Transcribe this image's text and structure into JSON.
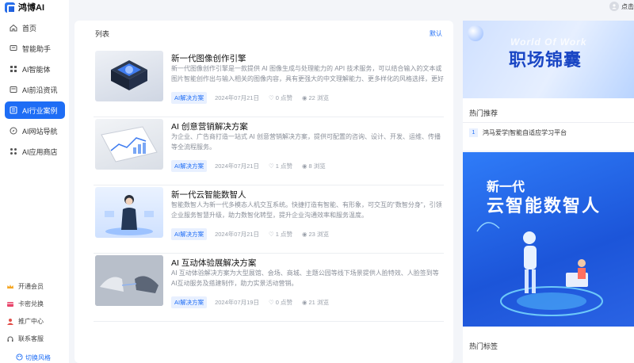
{
  "brand": {
    "name": "鸿博AI"
  },
  "nav": [
    {
      "label": "首页",
      "icon": "home-icon"
    },
    {
      "label": "智能助手",
      "icon": "chat-icon"
    },
    {
      "label": "AI智能体",
      "icon": "grid-icon"
    },
    {
      "label": "AI前沿资讯",
      "icon": "news-icon"
    },
    {
      "label": "AI行业案例",
      "icon": "case-icon",
      "active": true
    },
    {
      "label": "AI网站导航",
      "icon": "compass-icon"
    },
    {
      "label": "AI应用商店",
      "icon": "apps-icon"
    }
  ],
  "bottom_nav": [
    {
      "label": "开通会员",
      "icon": "crown-icon"
    },
    {
      "label": "卡密兑换",
      "icon": "card-icon"
    },
    {
      "label": "推广中心",
      "icon": "promo-icon"
    },
    {
      "label": "联系客服",
      "icon": "headset-icon"
    }
  ],
  "theme_toggle": "切换风格",
  "user": {
    "login_label": "点击"
  },
  "list": {
    "header": "列表",
    "sort_label": "默认",
    "articles": [
      {
        "title": "新一代图像创作引擎",
        "desc": "新一代图像创作引擎是一款提供 AI 图像生成与处理能力的 API 技术服务，可以结合输入的文本或图片智能创作出与输入相关的图像内容，具有更强大的中文理解能力、更多样化的风格选择，更好支持中...",
        "tag": "AI解决方案",
        "date": "2024年07月21日",
        "likes": "0 点赞",
        "views": "22 浏览"
      },
      {
        "title": "AI 创意营销解决方案",
        "desc": "为企业、广告商打造一站式 AI 创意营销解决方案，提供可配置的咨询、设计、开发、运维、传播等全流程服务。",
        "tag": "AI解决方案",
        "date": "2024年07月21日",
        "likes": "1 点赞",
        "views": "8 浏览"
      },
      {
        "title": "新一代云智能数智人",
        "desc": "智能数智人为新一代多模态人机交互系统。快捷打造有智能、有形象，可交互的\"数智分身\"，引领企业服务智慧升级，助力数智化转型，提升企业沟通效率和服务温度。",
        "tag": "AI解决方案",
        "date": "2024年07月21日",
        "likes": "1 点赞",
        "views": "23 浏览"
      },
      {
        "title": "AI 互动体验展解决方案",
        "desc": "AI 互动体验解决方案为大型展馆、会场、商城、主题公园等线下场景提供人脸特效、人脸签到等AI互动服务及搭建制作，助力实景活动营销。",
        "tag": "AI解决方案",
        "date": "2024年07月19日",
        "likes": "0 点赞",
        "views": "21 浏览"
      }
    ]
  },
  "right": {
    "banner_top": {
      "bg_text": "World Of Work",
      "title": "职场锦囊"
    },
    "hot": {
      "title": "热门推荐",
      "items": [
        {
          "num": "1",
          "label": "鸿马爱学|智能自适应学习平台"
        }
      ]
    },
    "banner_bottom": {
      "line1": "新一代",
      "line2": "云智能数智人"
    },
    "tags_title": "热门标签"
  },
  "colors": {
    "accent": "#1e6df5",
    "tag_bg": "#e8f0ff",
    "page_bg": "#f3f5f9"
  }
}
